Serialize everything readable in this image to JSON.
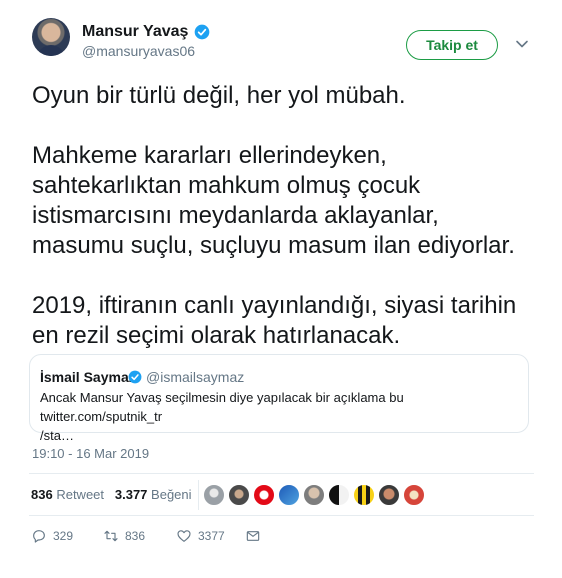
{
  "author": {
    "name": "Mansur Yavaş",
    "handle": "@mansuryavas06"
  },
  "follow_label": "Takip et",
  "tweet_text": "Oyun bir türlü değil, her yol mübah.\n\nMahkeme kararları ellerindeyken,\nsahtekarlıktan mahkum olmuş çocuk\nistismarcısını meydanlarda aklayanlar,\nmasumu suçlu, suçluyu masum ilan ediyorlar.\n\n2019, iftiranın canlı yayınlandığı, siyasi tarihin\nen rezil seçimi olarak hatırlanacak.",
  "quote": {
    "name": "İsmail Saymaz",
    "handle": "@ismailsaymaz",
    "text": "Ancak Mansur Yavaş seçilmesin diye yapılacak bir açıklama bu twitter.com/sputnik_tr\n/sta…"
  },
  "timestamp": "19:10 - 16 Mar 2019",
  "stats": {
    "retweets_count": "836",
    "retweets_label": "Retweet",
    "likes_count": "3.377",
    "likes_label": "Beğeni"
  },
  "actions": {
    "reply_count": "329",
    "retweet_count": "836",
    "like_count": "3377"
  },
  "colors": {
    "follow_green": "#1c9c45",
    "verified_blue": "#1da1f2",
    "meta_gray": "#657786"
  }
}
